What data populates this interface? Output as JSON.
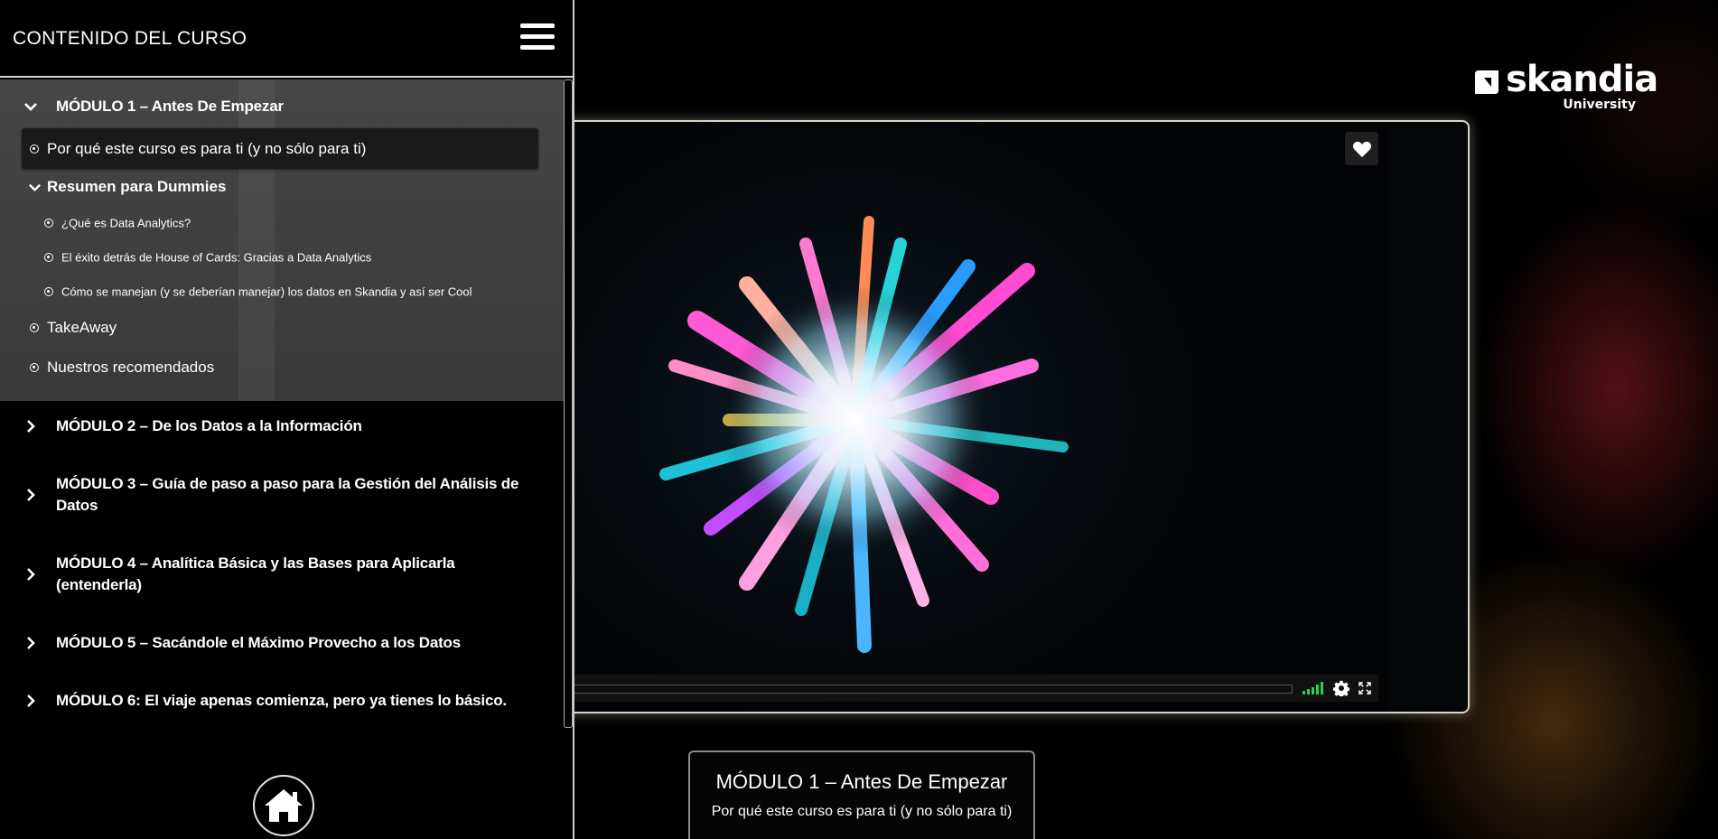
{
  "sidebar": {
    "title": "CONTENIDO DEL CURSO",
    "menu_icon": "hamburger-menu-icon",
    "modules": [
      {
        "label": "MÓDULO 1 – Antes De Empezar",
        "expanded": true,
        "lessons": [
          {
            "label": "Por qué este curso es para ti (y no sólo para ti)",
            "active": true
          },
          {
            "label": "Resumen para Dummies",
            "expanded": true,
            "sublessons": [
              {
                "label": "¿Qué es Data Analytics?"
              },
              {
                "label": "El éxito detrás de House of Cards: Gracias a Data Analytics"
              },
              {
                "label": "Cómo se manejan (y se deberían manejar) los datos en Skandia y así ser Cool"
              }
            ]
          },
          {
            "label": "TakeAway"
          },
          {
            "label": "Nuestros recomendados"
          }
        ]
      },
      {
        "label_line1": "MÓDULO 2 – De los Datos a la Información",
        "label_line2": ""
      },
      {
        "label_line1": "MÓDULO 3 – Guía de paso a paso para la Gestión del Análisis de",
        "label_line2": "Datos"
      },
      {
        "label_line1": "MÓDULO 4 – Analítica Básica y las Bases para Aplicarla",
        "label_line2": "(entenderla)"
      },
      {
        "label_line1": "MÓDULO 5 – Sacándole el Máximo Provecho a los Datos",
        "label_line2": ""
      },
      {
        "label_line1": "MÓDULO 6: El viaje apenas comienza, pero ya tienes lo básico.",
        "label_line2": ""
      }
    ],
    "home_icon": "home-icon"
  },
  "logo": {
    "word": "skandia",
    "sub": "University"
  },
  "video": {
    "favorite_icon": "heart-icon",
    "progress": 0,
    "volume_icon": "volume-bars-icon",
    "settings_icon": "gear-icon",
    "fullscreen_icon": "fullscreen-icon",
    "colors": {
      "volume": "#2bd14a",
      "frame": "#d9d4c8"
    }
  },
  "caption": {
    "title": "MÓDULO 1 – Antes De Empezar",
    "subtitle": "Por qué este curso es para ti (y no sólo para ti)"
  }
}
